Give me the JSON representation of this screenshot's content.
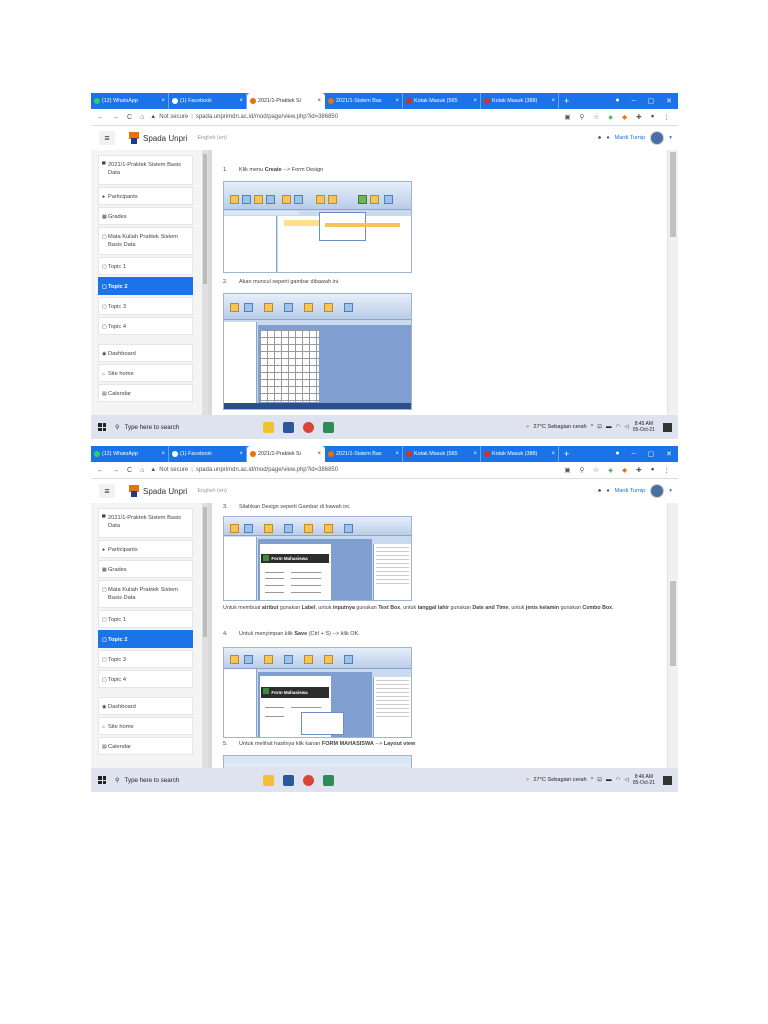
{
  "screenshots": [
    {
      "tabs": [
        {
          "label": "(12) WhatsApp",
          "color": "#25d366"
        },
        {
          "label": "(1) Facebook",
          "color": "#1877f2"
        },
        {
          "label": "2021/1-Praktek Si",
          "color": "#e8710a",
          "active": true
        },
        {
          "label": "2021/1-Sistem Bas",
          "color": "#e8710a"
        },
        {
          "label": "Kotak Masuk (565",
          "color": "#d93025"
        },
        {
          "label": "Kotak Masuk (388)",
          "color": "#d93025"
        }
      ],
      "url": "spada.unprimdn.ac.id/mod/page/view.php?id=386850",
      "not_secure": "Not secure",
      "brand": "Spada Unpri",
      "language": "English (en)",
      "user": "Mardi Turnip",
      "sidebar": [
        {
          "label": "2021/1-Praktek Sistem Basis Data",
          "icon": "graduation-cap-icon"
        },
        {
          "label": "Participants",
          "icon": "users-icon"
        },
        {
          "label": "Grades",
          "icon": "table-icon"
        },
        {
          "label": "Mata Kuliah Praktek Sistem Basis Data",
          "icon": "folder-icon"
        },
        {
          "label": "Topic 1",
          "icon": "folder-icon"
        },
        {
          "label": "Topic 2",
          "icon": "folder-icon",
          "active": true
        },
        {
          "label": "Topic 3",
          "icon": "folder-icon"
        },
        {
          "label": "Topic 4",
          "icon": "folder-icon"
        },
        {
          "label": "Dashboard",
          "icon": "dashboard-icon"
        },
        {
          "label": "Site home",
          "icon": "home-icon"
        },
        {
          "label": "Calendar",
          "icon": "calendar-icon"
        }
      ],
      "content": {
        "step1_num": "1.",
        "step1_pre": "Klik menu ",
        "step1_bold": "Create",
        "step1_post": " --> Form Design",
        "step2_num": "2.",
        "step2": "Akan muncul seperti gambar dibawah ini."
      },
      "taskbar": {
        "search": "Type here to search",
        "weather": "27°C  Sebagian cerah",
        "time": "8:45 AM",
        "date": "05-Oct-21"
      }
    },
    {
      "tabs": [
        {
          "label": "(12) WhatsApp",
          "color": "#25d366"
        },
        {
          "label": "(1) Facebook",
          "color": "#1877f2"
        },
        {
          "label": "2021/1-Praktek Si",
          "color": "#e8710a",
          "active": true
        },
        {
          "label": "2021/1-Sistem Bas",
          "color": "#e8710a"
        },
        {
          "label": "Kotak Masuk (565",
          "color": "#d93025"
        },
        {
          "label": "Kotak Masuk (388)",
          "color": "#d93025"
        }
      ],
      "url": "spada.unprimdn.ac.id/mod/page/view.php?id=386850",
      "not_secure": "Not secure",
      "brand": "Spada Unpri",
      "language": "English (en)",
      "user": "Mardi Turnip",
      "sidebar": [
        {
          "label": "2021/1-Praktek Sistem Basis Data",
          "icon": "graduation-cap-icon"
        },
        {
          "label": "Participants",
          "icon": "users-icon"
        },
        {
          "label": "Grades",
          "icon": "table-icon"
        },
        {
          "label": "Mata Kuliah Praktek Sistem Basis Data",
          "icon": "folder-icon"
        },
        {
          "label": "Topic 1",
          "icon": "folder-icon"
        },
        {
          "label": "Topic 2",
          "icon": "folder-icon",
          "active": true
        },
        {
          "label": "Topic 3",
          "icon": "folder-icon"
        },
        {
          "label": "Topic 4",
          "icon": "folder-icon"
        },
        {
          "label": "Dashboard",
          "icon": "dashboard-icon"
        },
        {
          "label": "Site home",
          "icon": "home-icon"
        },
        {
          "label": "Calendar",
          "icon": "calendar-icon"
        }
      ],
      "content": {
        "step3_num": "3.",
        "step3": "Silahkan Design seperti Gambar di bawah ini.",
        "form_title": "Form Mahasiswa",
        "para": {
          "t1": "Untuk membuat ",
          "b1": "atribut",
          "t2": " gunakan ",
          "b2": "Label",
          "t3": ", untuk ",
          "b3": "inputnya",
          "t4": " gunakan ",
          "b4": "Text Box",
          "t5": ", untuk ",
          "b5": "tanggal lahir",
          "t6": " gunakan ",
          "b6": "Date and Time",
          "t7": ", untuk ",
          "b7": "jenis kelamin",
          "t8": " gunakan ",
          "b8": "Combo Box",
          "t9": "."
        },
        "step4_num": "4.",
        "step4_pre": "Untuk menyimpan klik ",
        "step4_bold": "Save",
        "step4_post": " (Ctrl + S) --> klik OK.",
        "step5_num": "5.",
        "step5_pre": "Untuk melihat hasilnya klik kanan ",
        "step5_bold": "FORM MAHASISWA",
        "step5_mid": " --> ",
        "step5_bold2": "Layout view"
      },
      "taskbar": {
        "search": "Type here to search",
        "weather": "27°C  Sebagian cerah",
        "time": "8:46 AM",
        "date": "05-Oct-21"
      }
    }
  ]
}
